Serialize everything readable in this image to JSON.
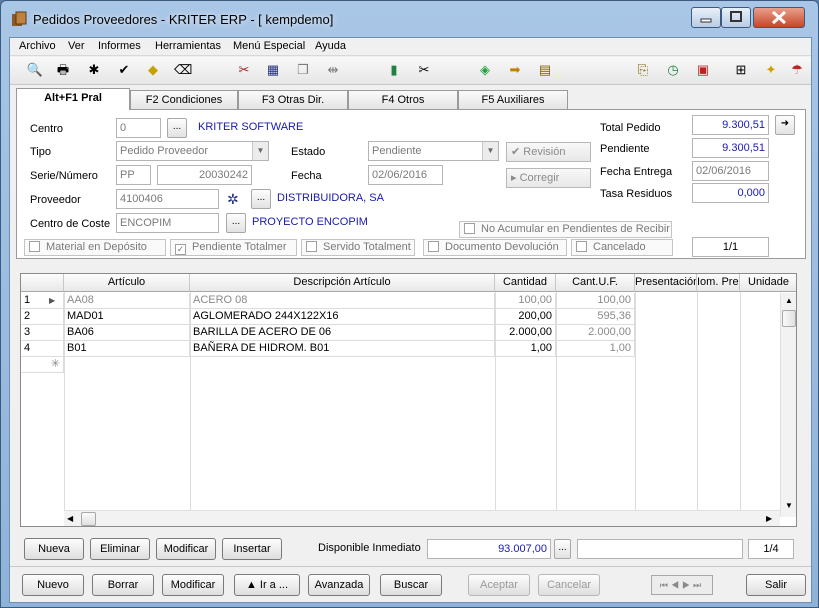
{
  "window": {
    "title": "Pedidos Proveedores - KRITER ERP - [ kempdemo]"
  },
  "menu": [
    "Archivo",
    "Ver",
    "Informes",
    "Herramientas",
    "Menú Especial",
    "Ayuda"
  ],
  "toolbar_icons": [
    "preview-icon",
    "print-icon",
    "asterisk-icon",
    "check-icon",
    "warning-icon",
    "eraser-icon",
    "tools-icon",
    "calculator-icon",
    "copy-icon",
    "split-icon",
    "book-icon",
    "scissors-icon",
    "tag-icon",
    "arrow-right-icon",
    "calendar-icon",
    "paperclip-icon",
    "clock-icon",
    "pdf-icon",
    "tree-icon",
    "bulb-icon",
    "umbrella-icon"
  ],
  "tabs": [
    "Alt+F1 Pral",
    "F2 Condiciones",
    "F3 Otras Dir.",
    "F4 Otros",
    "F5 Auxiliares"
  ],
  "header": {
    "centro_label": "Centro",
    "centro_value": "0",
    "centro_name": "KRITER SOFTWARE",
    "tipo_label": "Tipo",
    "tipo_value": "Pedido Proveedor",
    "estado_label": "Estado",
    "estado_value": "Pendiente",
    "revision_label": "Revisión",
    "serie_label": "Serie/Número",
    "serie_value": "PP",
    "numero_value": "20030242",
    "fecha_label": "Fecha",
    "fecha_value": "02/06/2016",
    "corregir_label": "Corregir",
    "proveedor_label": "Proveedor",
    "proveedor_value": "4100406",
    "proveedor_name": "DISTRIBUIDORA, SA",
    "coste_label": "Centro de Coste",
    "coste_value": "ENCOPIM",
    "coste_name": "PROYECTO ENCOPIM",
    "total_label": "Total Pedido",
    "total_value": "9.300,51",
    "pendiente_label": "Pendiente",
    "pendiente_value": "9.300,51",
    "entrega_label": "Fecha Entrega",
    "entrega_value": "02/06/2016",
    "tasa_label": "Tasa Residuos",
    "tasa_value": "0,000",
    "no_acumular_label": "No Acumular en Pendientes de Recibir",
    "checks": [
      "Material en Depósito",
      "Pendiente Totalmer",
      "Servido Totalment",
      "Documento Devolución",
      "Cancelado"
    ],
    "page_indicator": "1/1"
  },
  "grid": {
    "columns": [
      "Artículo",
      "Descripción Artículo",
      "Cantidad",
      "Cant.U.F.",
      "Presentación",
      "Iom. Pre:",
      "Unidade"
    ],
    "rows": [
      {
        "n": "1",
        "articulo": "AA08",
        "descripcion": "ACERO 08",
        "cantidad": "100,00",
        "cantuf": "100,00"
      },
      {
        "n": "2",
        "articulo": "MAD01",
        "descripcion": "AGLOMERADO 244X122X16",
        "cantidad": "200,00",
        "cantuf": "595,36"
      },
      {
        "n": "3",
        "articulo": "BA06",
        "descripcion": "BARILLA DE ACERO DE 06",
        "cantidad": "2.000,00",
        "cantuf": "2.000,00"
      },
      {
        "n": "4",
        "articulo": "B01",
        "descripcion": "BAÑERA DE HIDROM. B01",
        "cantidad": "1,00",
        "cantuf": "1,00"
      }
    ],
    "new_row_marker": "✳"
  },
  "lines_bar": {
    "nueva": "Nueva",
    "eliminar": "Eliminar",
    "modificar": "Modificar",
    "insertar": "Insertar",
    "disponible_label": "Disponible Inmediato",
    "disponible_value": "93.007,00",
    "page": "1/4"
  },
  "bottom_bar": {
    "nuevo": "Nuevo",
    "borrar": "Borrar",
    "modificar": "Modificar",
    "ira": "Ir a ...",
    "avanzada": "Avanzada",
    "buscar": "Buscar",
    "aceptar": "Aceptar",
    "cancelar": "Cancelar",
    "salir": "Salir"
  }
}
